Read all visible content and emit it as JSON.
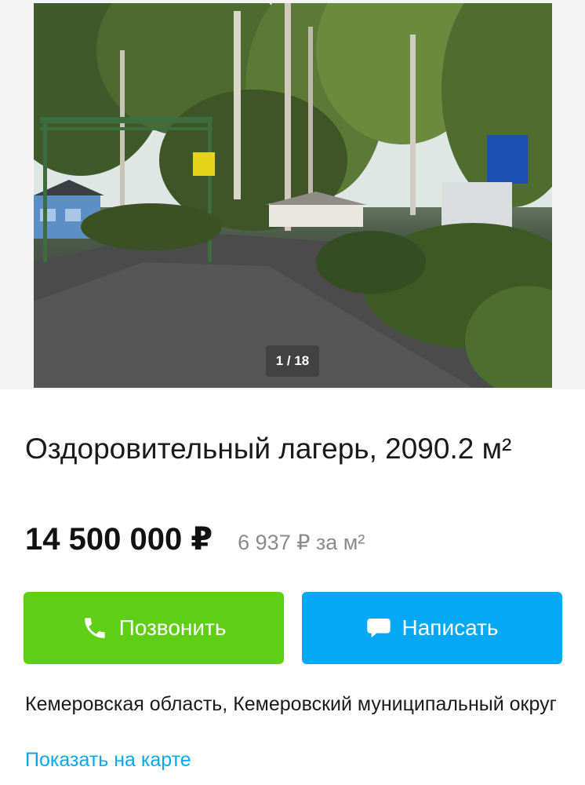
{
  "gallery": {
    "counter": "1 / 18",
    "current": 1,
    "total": 18
  },
  "listing": {
    "title": "Оздоровительный лагерь, 2090.2 м²",
    "price": "14 500 000 ₽",
    "price_per_m2": "6 937 ₽ за м²"
  },
  "actions": {
    "call_label": "Позвонить",
    "write_label": "Написать",
    "call_icon": "phone-icon",
    "write_icon": "chat-bubble-icon"
  },
  "location": {
    "address": "Кемеровская область, Кемеровский муниципальный округ",
    "map_link": "Показать на карте"
  },
  "colors": {
    "call_button": "#5fcf16",
    "write_button": "#04a8f4",
    "link": "#04a8f4",
    "secondary_text": "#8a8a8a"
  }
}
